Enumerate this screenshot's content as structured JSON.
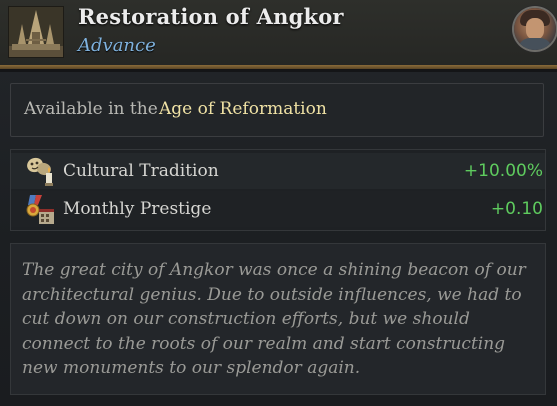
{
  "header": {
    "title": "Restoration of Angkor",
    "subtitle": "Advance",
    "left_icon": "temple-icon",
    "right_icon": "ruler-portrait"
  },
  "availability": {
    "prefix": "Available in the",
    "age": "Age of Reformation"
  },
  "modifiers": [
    {
      "icon": "masks-candle-icon",
      "label": "Cultural Tradition",
      "value": "+10.00%"
    },
    {
      "icon": "medal-building-icon",
      "label": "Monthly Prestige",
      "value": "+0.10"
    }
  ],
  "description": "The great city of Angkor was once a shining beacon of our architectural genius. Due to outside influences, we had to cut down on our construction efforts, but we should connect to the roots of our realm and start constructing new monuments to our splendor again.",
  "colors": {
    "title": "#ececec",
    "subtitle": "#7fb2de",
    "age_highlight": "#efe1a4",
    "positive_value": "#5ecb5e",
    "header_rule": "#8a6c3a"
  }
}
